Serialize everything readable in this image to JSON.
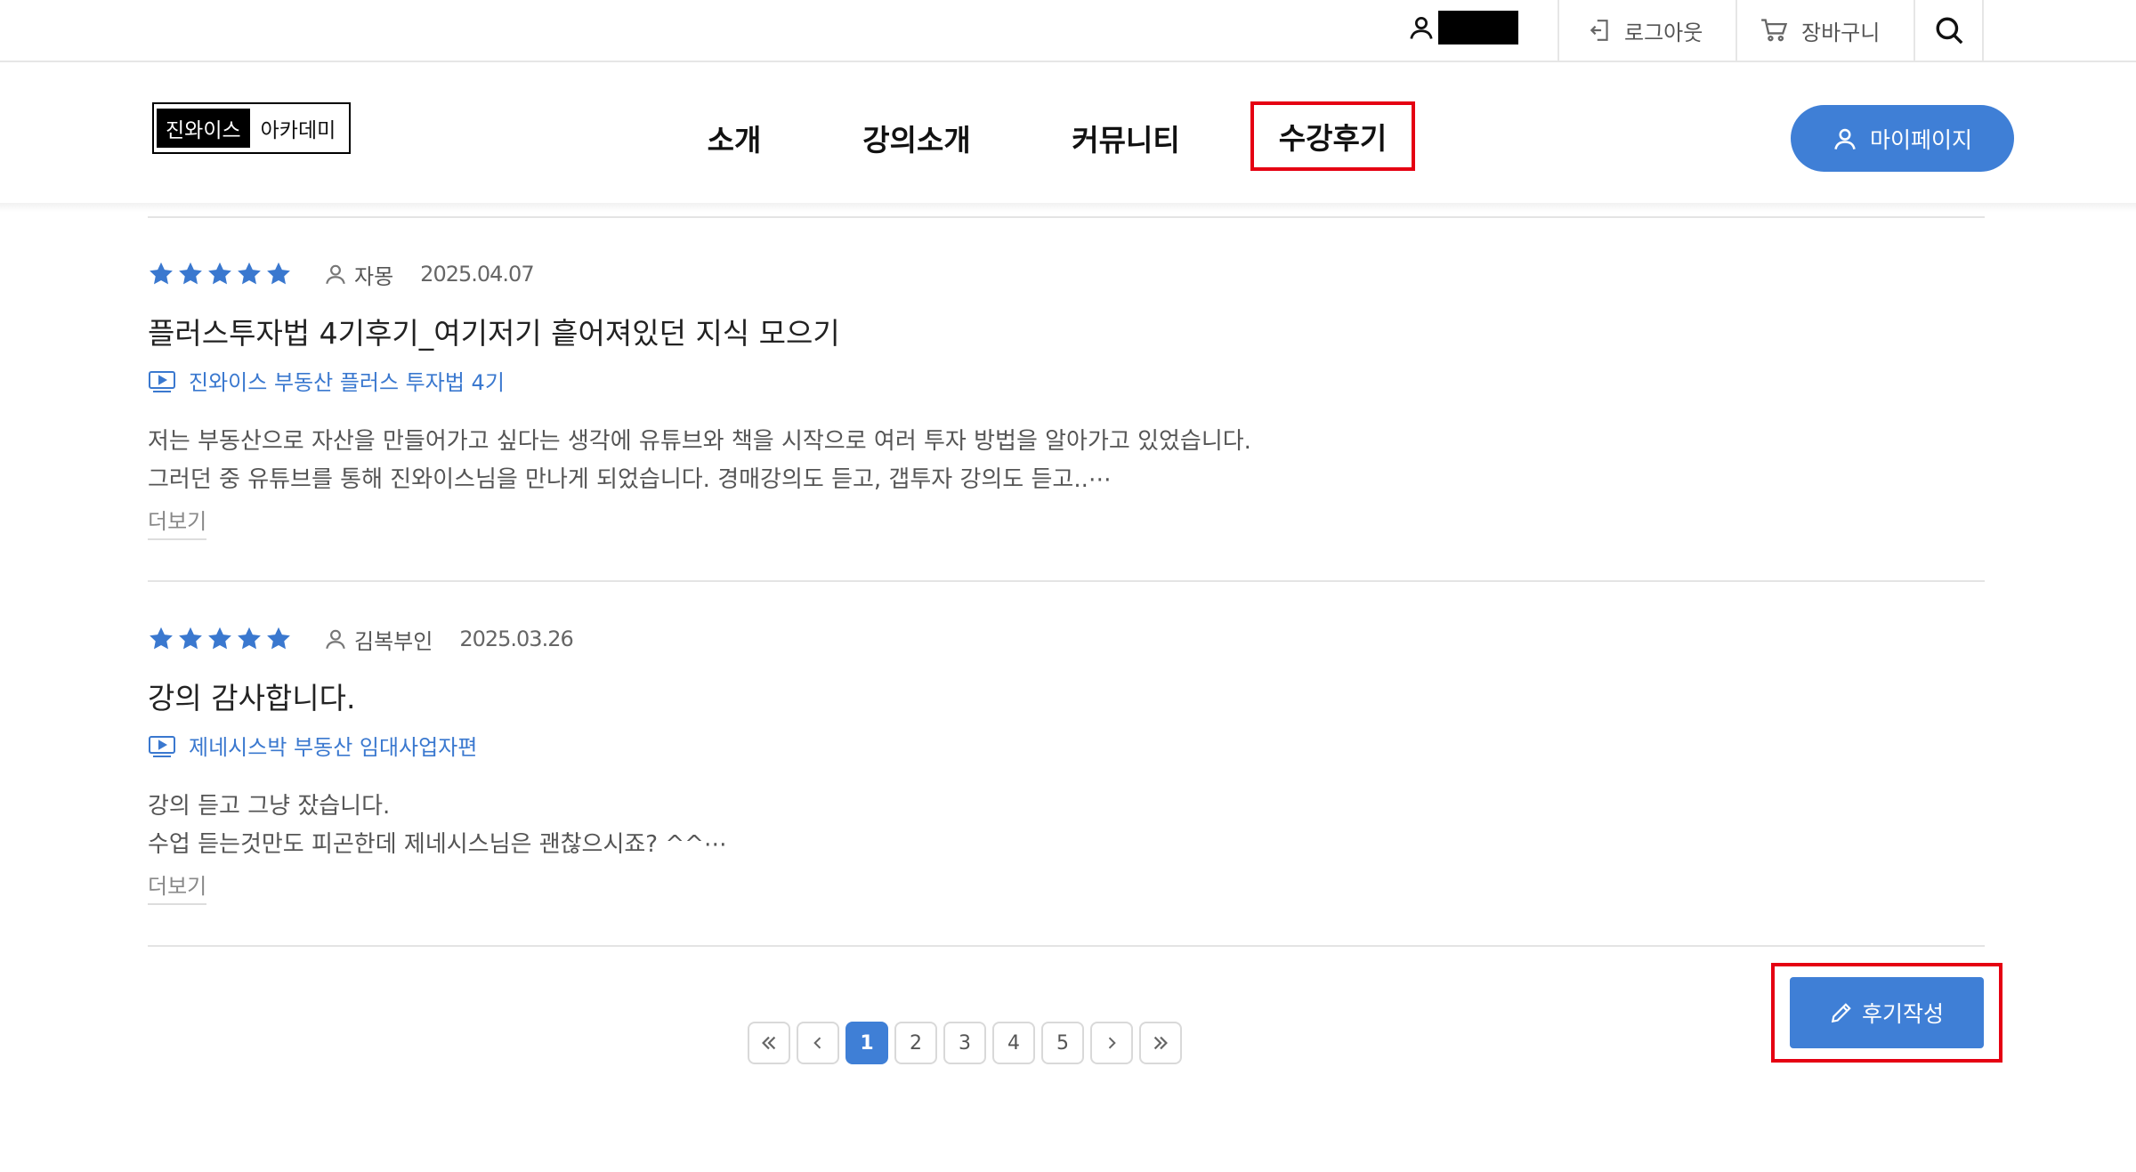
{
  "topbar": {
    "logout_label": "로그아웃",
    "cart_label": "장바구니"
  },
  "header": {
    "logo_black": "진와이스",
    "logo_white": "아카데미",
    "nav": [
      "소개",
      "강의소개",
      "커뮤니티",
      "수강후기"
    ],
    "active_nav": "수강후기",
    "mypage_label": "마이페이지"
  },
  "reviews": [
    {
      "rating": 5,
      "author": "자몽",
      "date": "2025.04.07",
      "title": "플러스투자법 4기후기_여기저기 흩어져있던 지식 모으기",
      "course": "진와이스 부동산 플러스 투자법 4기",
      "body": [
        "저는 부동산으로 자산을 만들어가고 싶다는 생각에 유튜브와 책을 시작으로 여러 투자 방법을 알아가고 있었습니다.",
        "그러던 중 유튜브를 통해 진와이스님을 만나게 되었습니다. 경매강의도 듣고, 갭투자 강의도 듣고..⋯"
      ],
      "more_label": "더보기"
    },
    {
      "rating": 5,
      "author": "김복부인",
      "date": "2025.03.26",
      "title": "강의 감사합니다.",
      "course": "제네시스박 부동산 임대사업자편",
      "body": [
        "강의 듣고 그냥 잤습니다.",
        "수업 듣는것만도 피곤한데 제네시스님은 괜찮으시죠? ^^⋯"
      ],
      "more_label": "더보기"
    }
  ],
  "pagination": {
    "pages": [
      "1",
      "2",
      "3",
      "4",
      "5"
    ],
    "current": "1"
  },
  "write_button_label": "후기작성",
  "colors": {
    "accent": "#3f7fd6",
    "highlight": "#e50012",
    "star": "#3a78cf"
  }
}
